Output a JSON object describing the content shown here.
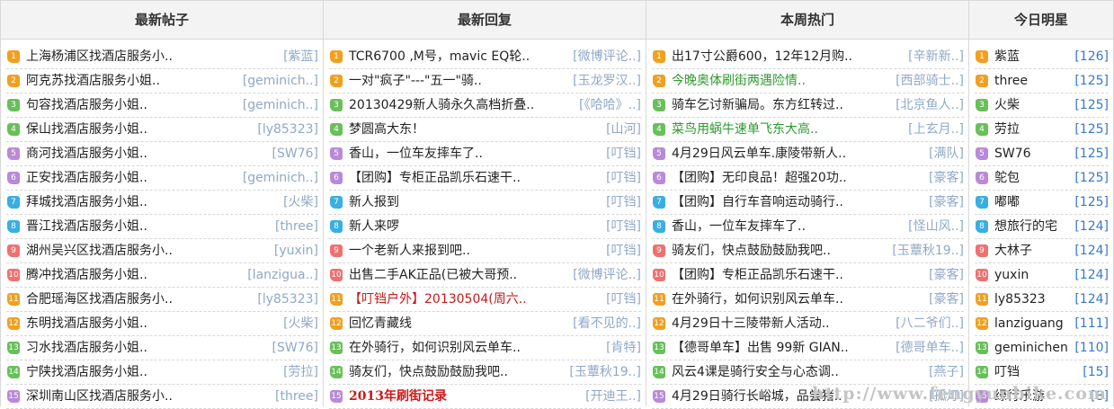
{
  "colors": {
    "badges": [
      "#f0a020",
      "#f0a020",
      "#69bf5a",
      "#69bf5a",
      "#b98ad8",
      "#b98ad8",
      "#3aaee0",
      "#3aaee0",
      "#ef7070",
      "#ef7070",
      "#f0a020",
      "#f0a020",
      "#69bf5a",
      "#69bf5a",
      "#b98ad8"
    ],
    "author": "#8fa8c8",
    "count": "#3878c8",
    "highlight_green": "#2e9a2e",
    "highlight_red": "#c41a1a"
  },
  "columns": [
    {
      "heading": "最新帖子",
      "items": [
        {
          "rank": "1",
          "title": "上海杨浦区找酒店服务小..",
          "meta": "[紫蓝]"
        },
        {
          "rank": "2",
          "title": "阿克苏找酒店服务小姐..",
          "meta": "[geminich..]"
        },
        {
          "rank": "3",
          "title": "句容找酒店服务小姐..",
          "meta": "[geminich..]"
        },
        {
          "rank": "4",
          "title": "保山找酒店服务小姐..",
          "meta": "[ly85323]"
        },
        {
          "rank": "5",
          "title": "商河找酒店服务小姐..",
          "meta": "[SW76]"
        },
        {
          "rank": "6",
          "title": "正安找酒店服务小姐..",
          "meta": "[geminich..]"
        },
        {
          "rank": "7",
          "title": "拜城找酒店服务小姐..",
          "meta": "[火柴]"
        },
        {
          "rank": "8",
          "title": "晋江找酒店服务小姐..",
          "meta": "[three]"
        },
        {
          "rank": "9",
          "title": "湖州吴兴区找酒店服务小..",
          "meta": "[yuxin]"
        },
        {
          "rank": "10",
          "title": "腾冲找酒店服务小姐..",
          "meta": "[lanzigua..]"
        },
        {
          "rank": "11",
          "title": "合肥瑶海区找酒店服务小..",
          "meta": "[ly85323]"
        },
        {
          "rank": "12",
          "title": "东明找酒店服务小姐..",
          "meta": "[火柴]"
        },
        {
          "rank": "13",
          "title": "习水找酒店服务小姐..",
          "meta": "[SW76]"
        },
        {
          "rank": "14",
          "title": "宁陕找酒店服务小姐..",
          "meta": "[劳拉]"
        },
        {
          "rank": "15",
          "title": "深圳南山区找酒店服务小..",
          "meta": "[three]"
        }
      ]
    },
    {
      "heading": "最新回复",
      "items": [
        {
          "rank": "1",
          "title": "TCR6700 ,M号，mavic EQ轮..",
          "meta": "[微博评论..]"
        },
        {
          "rank": "2",
          "title": "一对\"疯子\"---\"五一\"骑..",
          "meta": "[玉龙罗汉..]"
        },
        {
          "rank": "3",
          "title": "20130429新人骑永久高档折叠..",
          "meta": "[《哈哈》..]"
        },
        {
          "rank": "4",
          "title": "梦圆高大东！",
          "meta": "[山河]"
        },
        {
          "rank": "5",
          "title": "香山，一位车友摔车了..",
          "meta": "[叮铛]"
        },
        {
          "rank": "6",
          "title": "【团购】专柜正品凯乐石速干..",
          "meta": "[叮铛]"
        },
        {
          "rank": "7",
          "title": "新人报到",
          "meta": "[叮铛]"
        },
        {
          "rank": "8",
          "title": "新人来啰",
          "meta": "[叮铛]"
        },
        {
          "rank": "9",
          "title": "一个老新人来报到吧..",
          "meta": "[叮铛]"
        },
        {
          "rank": "10",
          "title": "出售二手AK正品(已被大哥预..",
          "meta": "[微博评论..]"
        },
        {
          "rank": "11",
          "title": "【叮铛户外】20130504(周六..",
          "meta": "[叮铛]",
          "style": "red"
        },
        {
          "rank": "12",
          "title": "回忆青藏线",
          "meta": "[看不见的..]"
        },
        {
          "rank": "13",
          "title": "在外骑行，如何识别风云单车..",
          "meta": "[肯特]"
        },
        {
          "rank": "14",
          "title": "骑友们，快点鼓励鼓励我吧..",
          "meta": "[玉蕈秋19..]"
        },
        {
          "rank": "15",
          "title": "2013年刷街记录",
          "meta": "[开迪王..]",
          "style": "redbold"
        }
      ]
    },
    {
      "heading": "本周热门",
      "items": [
        {
          "rank": "1",
          "title": "出17寸公爵600，12年12月购..",
          "meta": "[辛新新..]"
        },
        {
          "rank": "2",
          "title": "今晚奥体刷街两遇险情..",
          "meta": "[西部骑士..]",
          "style": "green"
        },
        {
          "rank": "3",
          "title": "骑车乞讨新骗局。东方红转过..",
          "meta": "[北京鱼人..]"
        },
        {
          "rank": "4",
          "title": "菜鸟用蜗牛速单飞东大高..",
          "meta": "[上玄月..]",
          "style": "green"
        },
        {
          "rank": "5",
          "title": "4月29日风云单车.康陵带新人..",
          "meta": "[满队]"
        },
        {
          "rank": "6",
          "title": "【团购】无印良品！超强20功..",
          "meta": "[豪客]"
        },
        {
          "rank": "7",
          "title": "【团购】自行车音响运动骑行..",
          "meta": "[豪客]"
        },
        {
          "rank": "8",
          "title": "香山，一位车友摔车了..",
          "meta": "[怪山风..]"
        },
        {
          "rank": "9",
          "title": "骑友们，快点鼓励鼓励我吧..",
          "meta": "[玉蕈秋19..]"
        },
        {
          "rank": "10",
          "title": "【团购】专柜正品凯乐石速干..",
          "meta": "[豪客]"
        },
        {
          "rank": "11",
          "title": "在外骑行，如何识别风云单车..",
          "meta": "[豪客]"
        },
        {
          "rank": "12",
          "title": "4月29日十三陵带新人活动..",
          "meta": "[八二爷们..]"
        },
        {
          "rank": "13",
          "title": "【德哥单车】出售 99新 GIAN..",
          "meta": "[德哥单车..]"
        },
        {
          "rank": "14",
          "title": "风云4课是骑行安全与心态调..",
          "meta": "[燕子]"
        },
        {
          "rank": "15",
          "title": "4月29日骑行长峪城，品尝猪..",
          "meta": "[孤灯]"
        }
      ]
    },
    {
      "heading": "今日明星",
      "items": [
        {
          "rank": "1",
          "title": "紫蓝",
          "meta": "[126]"
        },
        {
          "rank": "2",
          "title": "three",
          "meta": "[125]"
        },
        {
          "rank": "3",
          "title": "火柴",
          "meta": "[125]"
        },
        {
          "rank": "4",
          "title": "劳拉",
          "meta": "[125]"
        },
        {
          "rank": "5",
          "title": "SW76",
          "meta": "[125]"
        },
        {
          "rank": "6",
          "title": "鸵包",
          "meta": "[125]"
        },
        {
          "rank": "7",
          "title": "嘟嘟",
          "meta": "[125]"
        },
        {
          "rank": "8",
          "title": "想旅行的宅",
          "meta": "[124]"
        },
        {
          "rank": "9",
          "title": "大林子",
          "meta": "[124]"
        },
        {
          "rank": "10",
          "title": "yuxin",
          "meta": "[124]"
        },
        {
          "rank": "11",
          "title": "ly85323",
          "meta": "[124]"
        },
        {
          "rank": "12",
          "title": "lanziguang",
          "meta": "[111]"
        },
        {
          "rank": "13",
          "title": "geminichen",
          "meta": "[110]"
        },
        {
          "rank": "14",
          "title": "叮铛",
          "meta": "[15]"
        },
        {
          "rank": "15",
          "title": "绿行乐游",
          "meta": "[8]"
        }
      ]
    }
  ],
  "watermark": "http://www.fengyunbike.com"
}
